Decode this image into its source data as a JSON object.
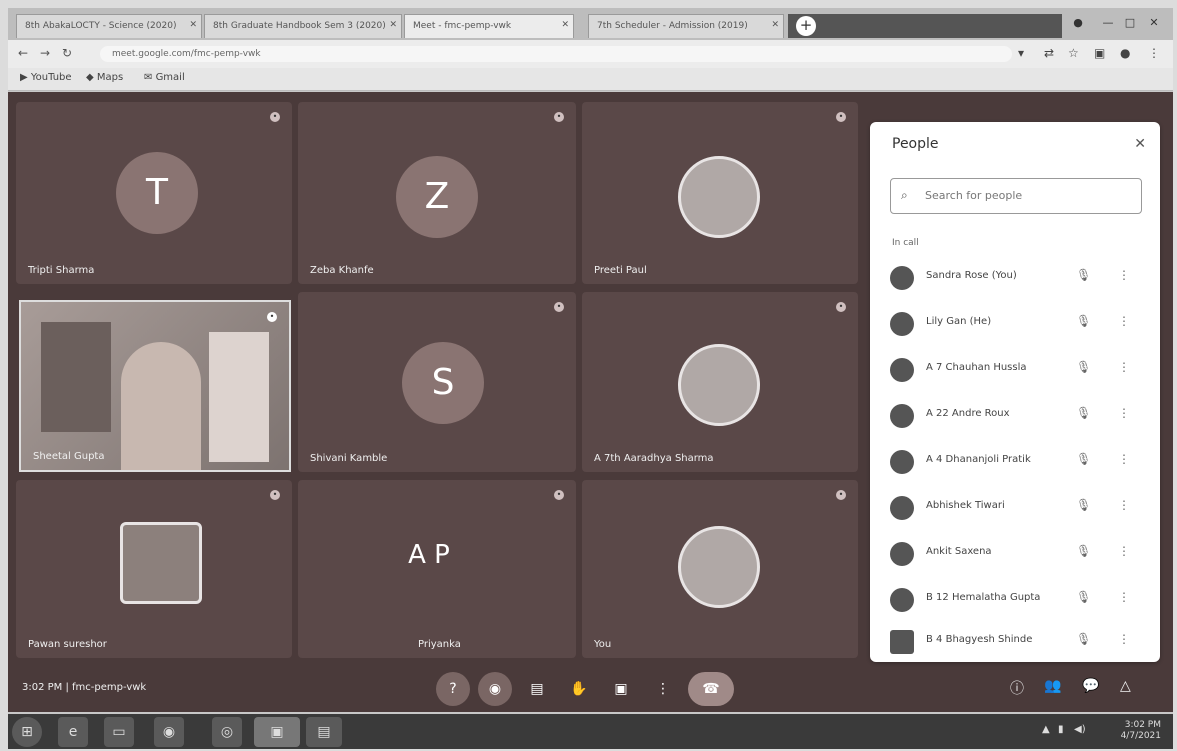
{
  "browser": {
    "tabs": [
      {
        "label": "8th AbakaLOCTY - Science (2020)"
      },
      {
        "label": "8th Graduate Handbook Sem 3 (2020)"
      },
      {
        "label": "Meet - fmc-pemp-vwk"
      },
      {
        "label": "7th Scheduler - Admission (2019)"
      }
    ],
    "new_tab": "+",
    "address": "meet.google.com/fmc-pemp-vwk",
    "bookmarks": [
      "YouTube",
      "Maps",
      "Gmail"
    ]
  },
  "meet": {
    "tiles": [
      {
        "initial": "T",
        "name": "Tripti Sharma"
      },
      {
        "initial": "Z",
        "name": "Zeba Khanfe"
      },
      {
        "initial": "",
        "name": "Preeti Paul"
      },
      {
        "initial": "",
        "name": "Sheetal Gupta"
      },
      {
        "initial": "S",
        "name": "Shivani Kamble"
      },
      {
        "initial": "",
        "name": "A 7th Aaradhya Sharma"
      },
      {
        "initial": "",
        "name": "Pawan sureshor"
      },
      {
        "initial": "A P",
        "name": "Priyanka"
      },
      {
        "initial": "",
        "name": "You"
      }
    ],
    "meeting_info": "3:02 PM  |  fmc-pemp-vwk",
    "controls": [
      "?",
      "◉",
      "▤",
      "✋",
      "▣",
      "⋮",
      "☎"
    ],
    "right_controls": [
      "ⓘ",
      "👥",
      "💬",
      "△"
    ]
  },
  "people_panel": {
    "title": "People",
    "search_placeholder": "Search for people",
    "section_label": "In call",
    "participants": [
      {
        "name": "Sandra Rose (You)"
      },
      {
        "name": "Lily Gan (He)"
      },
      {
        "name": "A 7 Chauhan Hussla"
      },
      {
        "name": "A 22 Andre Roux"
      },
      {
        "name": "A 4 Dhananjoli Pratik"
      },
      {
        "name": "Abhishek Tiwari"
      },
      {
        "name": "Ankit Saxena"
      },
      {
        "name": "B 12 Hemalatha Gupta"
      },
      {
        "name": "B 4 Bhagyesh Shinde"
      }
    ]
  },
  "taskbar": {
    "time": "3:02 PM",
    "date": "4/7/2021"
  }
}
